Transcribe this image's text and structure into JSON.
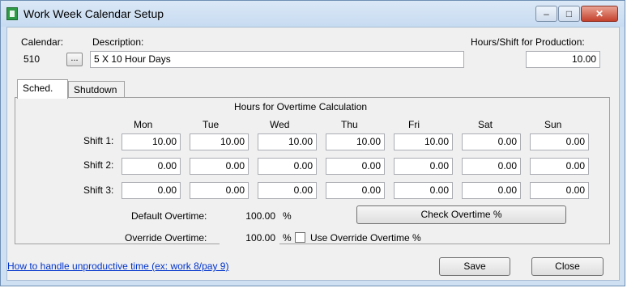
{
  "window": {
    "title": "Work Week Calendar Setup"
  },
  "header": {
    "calendar_label": "Calendar:",
    "calendar_value": "510",
    "picker_label": "...",
    "description_label": "Description:",
    "description_value": "5 X 10 Hour Days",
    "hours_label": "Hours/Shift for Production:",
    "hours_value": "10.00"
  },
  "tabs": [
    {
      "label": "Sched."
    },
    {
      "label": "Shutdown"
    }
  ],
  "schedule": {
    "heading": "Hours for Overtime Calculation",
    "days": [
      "Mon",
      "Tue",
      "Wed",
      "Thu",
      "Fri",
      "Sat",
      "Sun"
    ],
    "shifts": [
      {
        "label": "Shift 1:",
        "values": [
          "10.00",
          "10.00",
          "10.00",
          "10.00",
          "10.00",
          "0.00",
          "0.00"
        ]
      },
      {
        "label": "Shift 2:",
        "values": [
          "0.00",
          "0.00",
          "0.00",
          "0.00",
          "0.00",
          "0.00",
          "0.00"
        ]
      },
      {
        "label": "Shift 3:",
        "values": [
          "0.00",
          "0.00",
          "0.00",
          "0.00",
          "0.00",
          "0.00",
          "0.00"
        ]
      }
    ],
    "default_overtime_label": "Default Overtime:",
    "default_overtime_value": "100.00",
    "override_overtime_label": "Override Overtime:",
    "override_overtime_value": "100.00",
    "percent_sign": "%",
    "check_button": "Check Overtime %",
    "use_override_label": "Use Override Overtime %",
    "use_override_checked": false
  },
  "footer": {
    "link_text": "How to handle unproductive time (ex: work 8/pay 9)",
    "save_label": "Save",
    "close_label": "Close"
  },
  "window_controls": {
    "minimize": "–",
    "maximize": "□",
    "close": "✕"
  }
}
